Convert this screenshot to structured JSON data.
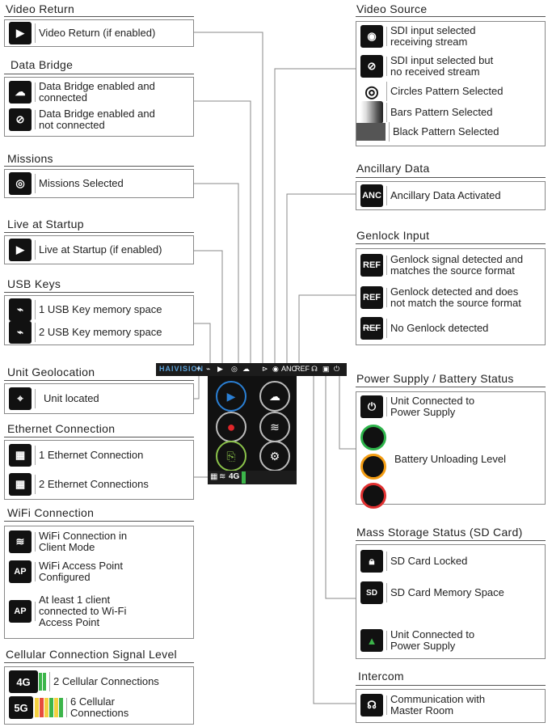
{
  "sections": {
    "video_return": {
      "title": "Video Return",
      "items": [
        {
          "icon": "video-return-icon",
          "label": "Video Return (if enabled)"
        }
      ]
    },
    "data_bridge": {
      "title": "Data Bridge",
      "items": [
        {
          "icon": "cloud-icon",
          "label": "Data Bridge enabled and\nconnected"
        },
        {
          "icon": "cloud-off-icon",
          "label": "Data Bridge enabled and\nnot connected"
        }
      ]
    },
    "missions": {
      "title": "Missions",
      "items": [
        {
          "icon": "target-icon",
          "label": "Missions Selected"
        }
      ]
    },
    "live_startup": {
      "title": "Live at Startup",
      "items": [
        {
          "icon": "play-icon",
          "label": "Live at Startup (if enabled)"
        }
      ]
    },
    "usb_keys": {
      "title": "USB Keys",
      "items": [
        {
          "icon": "usb-icon",
          "label": "1 USB Key memory space"
        },
        {
          "icon": "usb-double-icon",
          "label": "2 USB Key memory space"
        }
      ]
    },
    "geolocation": {
      "title": "Unit Geolocation",
      "items": [
        {
          "icon": "location-icon",
          "label": "Unit located"
        }
      ]
    },
    "ethernet": {
      "title": "Ethernet Connection",
      "items": [
        {
          "icon": "ethernet-icon",
          "label": "1 Ethernet Connection"
        },
        {
          "icon": "ethernet-double-icon",
          "label": "2 Ethernet Connections"
        }
      ]
    },
    "wifi": {
      "title": "WiFi Connection",
      "items": [
        {
          "icon": "wifi-icon",
          "label": "WiFi Connection in\nClient Mode"
        },
        {
          "icon": "wifi-ap-icon",
          "label": "WiFi Access Point\nConfigured"
        },
        {
          "icon": "wifi-ap-client-icon",
          "label": "At least 1 client\nconnected to Wi-Fi\nAccess Point"
        }
      ]
    },
    "cellular": {
      "title": "Cellular Connection Signal Level",
      "items": [
        {
          "icon": "cellular-4g-icon",
          "badge": "4G",
          "label": "2 Cellular Connections"
        },
        {
          "icon": "cellular-5g-icon",
          "badge": "5G",
          "label": "6 Cellular\nConnections"
        }
      ]
    },
    "video_source": {
      "title": "Video Source",
      "items": [
        {
          "icon": "sdi-receiving-icon",
          "label": "SDI input selected\nreceiving stream"
        },
        {
          "icon": "sdi-no-stream-icon",
          "label": "SDI input selected but\nno received stream"
        },
        {
          "icon": "circles-pattern-icon",
          "label": "Circles Pattern Selected"
        },
        {
          "icon": "bars-pattern-icon",
          "label": "Bars Pattern Selected"
        },
        {
          "icon": "black-pattern-icon",
          "label": "Black Pattern Selected"
        }
      ]
    },
    "ancillary": {
      "title": "Ancillary Data",
      "items": [
        {
          "icon": "anc-icon",
          "badge": "ANC",
          "label": "Ancillary Data Activated"
        }
      ]
    },
    "genlock": {
      "title": "Genlock Input",
      "items": [
        {
          "icon": "ref-icon",
          "badge": "REF",
          "label": "Genlock signal detected and\nmatches the source format"
        },
        {
          "icon": "ref-mismatch-icon",
          "badge": "REF",
          "label": "Genlock detected and does\nnot match the source format"
        },
        {
          "icon": "ref-none-icon",
          "badge": "REF",
          "label": "No Genlock detected"
        }
      ]
    },
    "power": {
      "title": "Power Supply / Battery Status",
      "items": [
        {
          "icon": "plug-icon",
          "label": "Unit Connected to\nPower Supply"
        },
        {
          "icon": "battery-levels-icon",
          "label": "Battery Unloading Level"
        }
      ]
    },
    "storage": {
      "title": "Mass Storage Status (SD Card)",
      "items": [
        {
          "icon": "sd-locked-icon",
          "label": "SD Card Locked"
        },
        {
          "icon": "sd-memory-icon",
          "label": "SD Card Memory Space"
        },
        {
          "icon": "sd-hot-icon",
          "label": "Unit Connected to\nPower Supply"
        }
      ]
    },
    "intercom": {
      "title": "Intercom",
      "items": [
        {
          "icon": "headset-icon",
          "label": "Communication with\nMaster Room"
        }
      ]
    }
  },
  "device": {
    "brand": "HAIVISION",
    "header_texts": {
      "anc": "ANC",
      "ref": "REF"
    },
    "footer_network": "4G"
  },
  "colors": {
    "battery_green": "#2db34a",
    "battery_orange": "#f39c12",
    "battery_red": "#e03030",
    "cell_green": "#3cb54a",
    "cell_yellow": "#f4d03f",
    "cell_red": "#e74c3c",
    "record_red": "#e0262a",
    "play_blue": "#2a7fd4",
    "ap_client_green": "#3cb54a"
  }
}
